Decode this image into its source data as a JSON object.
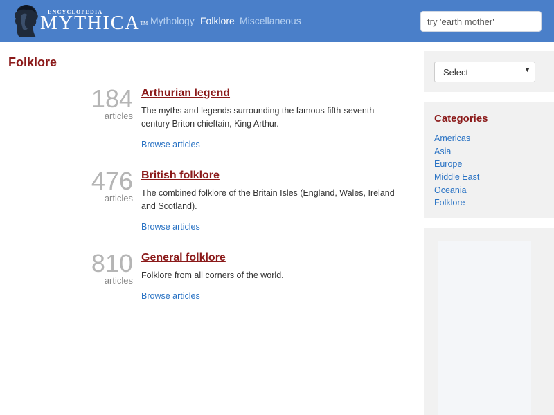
{
  "header": {
    "logo_small": "ENCYCLOPEDIA",
    "logo_big": "MYTHICA",
    "logo_tm": "TM",
    "nav": [
      {
        "label": "Mythology",
        "active": false
      },
      {
        "label": "Folklore",
        "active": true
      },
      {
        "label": "Miscellaneous",
        "active": false
      }
    ],
    "search_placeholder": "try 'earth mother'"
  },
  "main": {
    "title": "Folklore",
    "entries": [
      {
        "count": "184",
        "count_label": "articles",
        "title": "Arthurian legend",
        "description": "The myths and legends surrounding the famous fifth-seventh century Briton chieftain, King Arthur.",
        "link": "Browse articles"
      },
      {
        "count": "476",
        "count_label": "articles",
        "title": "British folklore",
        "description": "The combined folklore of the Britain Isles (England, Wales, Ireland and Scotland).",
        "link": "Browse articles"
      },
      {
        "count": "810",
        "count_label": "articles",
        "title": "General folklore",
        "description": "Folklore from all corners of the world.",
        "link": "Browse articles"
      }
    ]
  },
  "sidebar": {
    "select_label": "Select",
    "categories_title": "Categories",
    "categories": [
      "Americas",
      "Asia",
      "Europe",
      "Middle East",
      "Oceania",
      "Folklore"
    ]
  },
  "colors": {
    "header_bg": "#4a7fc9",
    "title_red": "#8b1a1a",
    "link_blue": "#2a73c4",
    "sidebar_bg": "#f1f1f1"
  }
}
